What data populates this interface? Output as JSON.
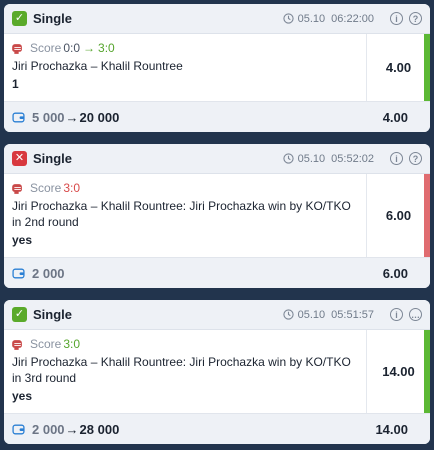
{
  "colors": {
    "won": "#5aaa2a",
    "lost": "#d8383e",
    "won_bar": "#5cb834",
    "lost_bar": "#e06c70",
    "page_background": "#22344d"
  },
  "bets": [
    {
      "status": "won",
      "status_icon": "check-icon",
      "type": "Single",
      "date": "05.10",
      "time": "06:22:00",
      "score_label": "Score",
      "score_old": "0:0",
      "score_arrow": "→",
      "score_new": "3:0",
      "event": "Jiri Prochazka – Khalil Rountree",
      "selection": "1",
      "odds": "4.00",
      "stake": "5 000",
      "amount_arrow": "→",
      "payout": "20 000",
      "footer_odds": "4.00"
    },
    {
      "status": "lost",
      "status_icon": "cross-icon",
      "type": "Single",
      "date": "05.10",
      "time": "05:52:02",
      "score_label": "Score",
      "score_new": "3:0",
      "event": "Jiri Prochazka – Khalil Rountree: Jiri Prochazka win by KO/TKO in 2nd round",
      "selection": "yes",
      "odds": "6.00",
      "stake": "2 000",
      "footer_odds": "6.00"
    },
    {
      "status": "won",
      "status_icon": "check-icon",
      "type": "Single",
      "date": "05.10",
      "time": "05:51:57",
      "score_label": "Score",
      "score_new": "3:0",
      "event": "Jiri Prochazka – Khalil Rountree: Jiri Prochazka win by KO/TKO in 3rd round",
      "selection": "yes",
      "odds": "14.00",
      "stake": "2 000",
      "amount_arrow": "→",
      "payout": "28 000",
      "footer_odds": "14.00"
    }
  ]
}
